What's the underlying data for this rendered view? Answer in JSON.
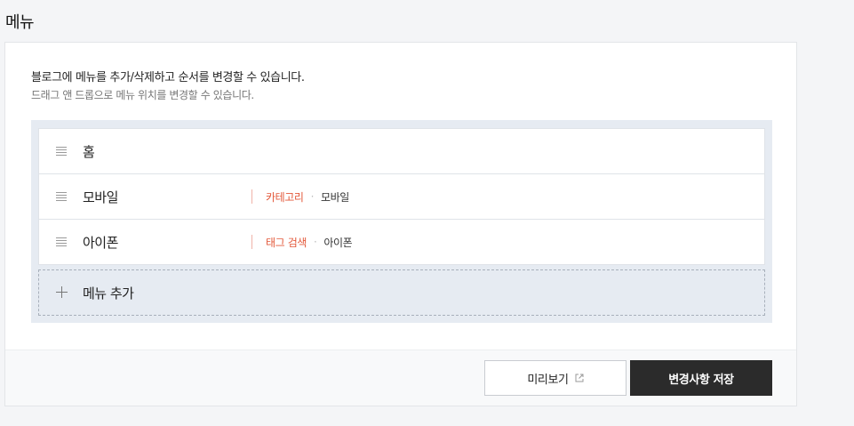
{
  "page": {
    "title": "메뉴"
  },
  "description": {
    "main": "블로그에 메뉴를 추가/삭제하고 순서를 변경할 수 있습니다.",
    "sub": "드래그 앤 드롭으로 메뉴 위치를 변경할 수 있습니다."
  },
  "menu": {
    "items": [
      {
        "name": "홈"
      },
      {
        "name": "모바일",
        "link_type": "카테고리",
        "separator": "·",
        "link_target": "모바일"
      },
      {
        "name": "아이폰",
        "link_type": "태그 검색",
        "separator": "·",
        "link_target": "아이폰"
      }
    ],
    "add_label": "메뉴 추가"
  },
  "footer": {
    "preview_label": "미리보기",
    "save_label": "변경사항 저장"
  },
  "colors": {
    "link_type": "#e3593b",
    "save_button_bg": "#2b2b2b",
    "menu_area_bg": "#e6ebf2"
  },
  "icons": {
    "drag_handle": "drag-handle-icon",
    "add": "plus-icon",
    "preview_external": "external-link-icon"
  }
}
